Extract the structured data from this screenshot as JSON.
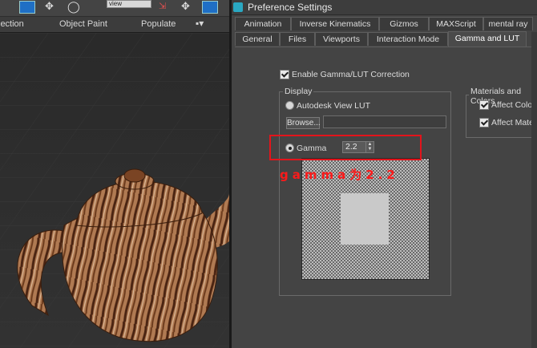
{
  "max": {
    "ribbon_tabs": [
      "lection",
      "Object Paint",
      "Populate"
    ],
    "toolbar_value": "view"
  },
  "dialog": {
    "title": "Preference Settings",
    "tabs_row1": [
      "Animation",
      "Inverse Kinematics",
      "Gizmos",
      "MAXScript",
      "mental ray"
    ],
    "tabs_row2": [
      "General",
      "Files",
      "Viewports",
      "Interaction Mode",
      "Gamma and LUT"
    ],
    "active_tab": "Gamma and LUT",
    "enable_gamma_label": "Enable Gamma/LUT Correction",
    "enable_gamma_checked": true,
    "display_group_title": "Display",
    "autodesk_lut_label": "Autodesk View LUT",
    "browse_label": "Browse...",
    "lut_path": "",
    "gamma_label": "Gamma",
    "gamma_value": "2.2",
    "materials_group_title": "Materials and Colors",
    "affect_color_label": "Affect Color S",
    "affect_material_label": "Affect Materia",
    "annotation": "gamma为2.2",
    "highlight_color": "#e3141b"
  }
}
